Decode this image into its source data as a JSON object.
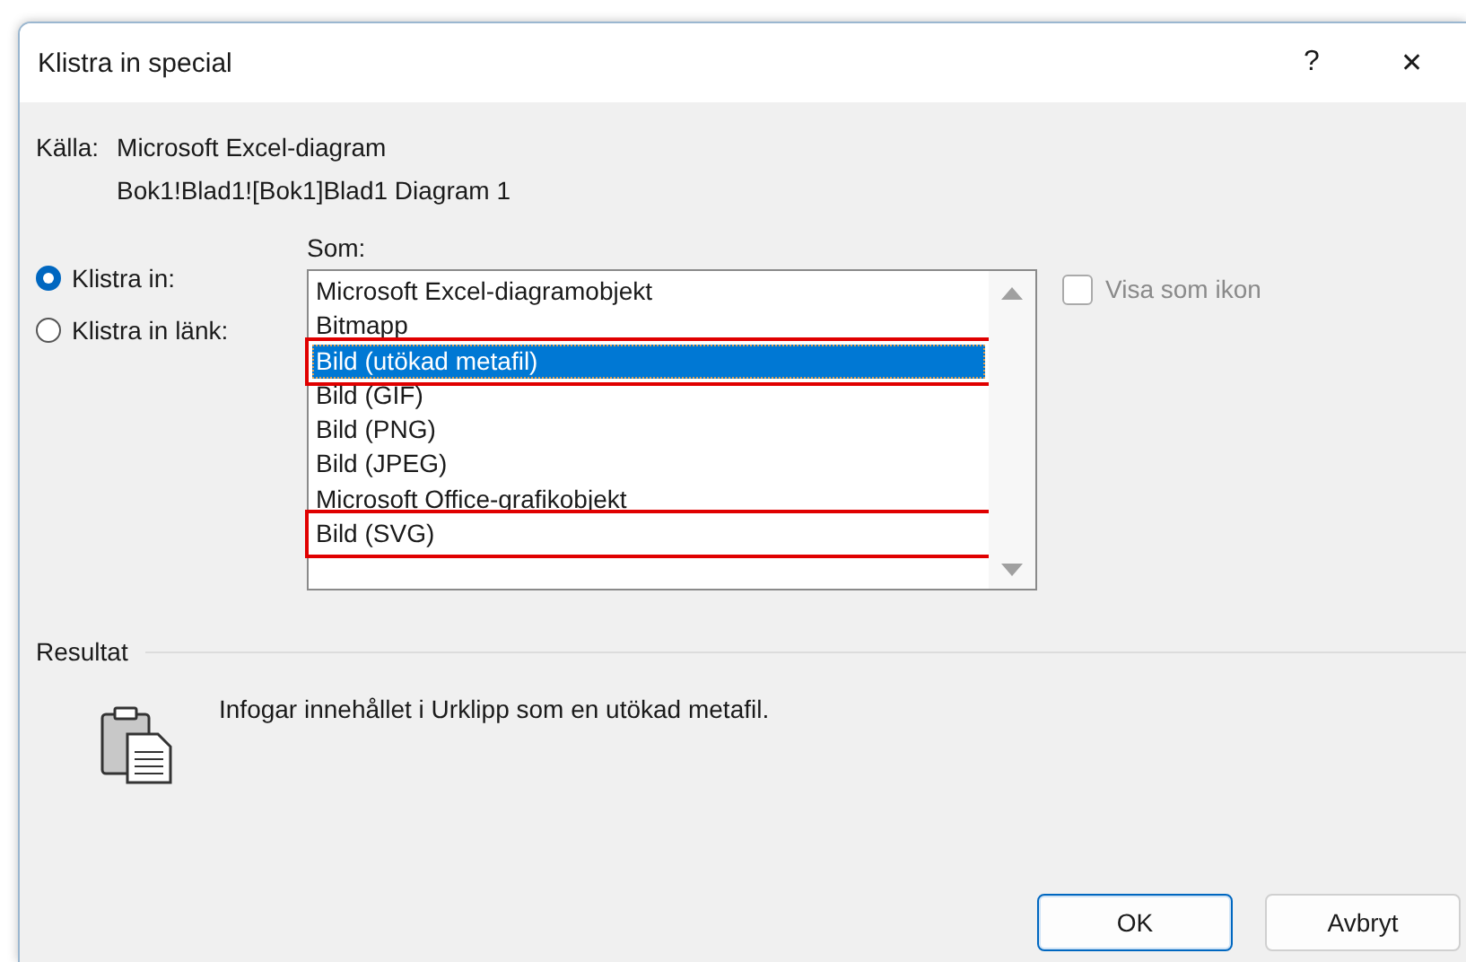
{
  "window": {
    "title": "Klistra in special",
    "help": "?",
    "close": "✕"
  },
  "source": {
    "label": "Källa:",
    "lines": [
      "Microsoft Excel-diagram",
      "Bok1!Blad1![Bok1]Blad1 Diagram 1"
    ]
  },
  "options": [
    {
      "label": "Klistra in:",
      "selected": true
    },
    {
      "label": "Klistra in länk:",
      "selected": false
    }
  ],
  "as_list": {
    "label": "Som:",
    "items": [
      {
        "label": "Microsoft Excel-diagramobjekt",
        "selected": false,
        "highlighted": false
      },
      {
        "label": "Bitmapp",
        "selected": false,
        "highlighted": false
      },
      {
        "label": "Bild (utökad metafil)",
        "selected": true,
        "highlighted": true
      },
      {
        "label": "Bild (GIF)",
        "selected": false,
        "highlighted": false
      },
      {
        "label": "Bild (PNG)",
        "selected": false,
        "highlighted": false
      },
      {
        "label": "Bild (JPEG)",
        "selected": false,
        "highlighted": false
      },
      {
        "label": "Microsoft Office-grafikobjekt",
        "selected": false,
        "highlighted": false
      },
      {
        "label": "Bild (SVG)",
        "selected": false,
        "highlighted": true
      }
    ]
  },
  "show_as_icon": {
    "label": "Visa som ikon",
    "checked": false,
    "disabled": true
  },
  "result": {
    "label": "Resultat",
    "text": "Infogar innehållet i Urklipp som en utökad metafil."
  },
  "buttons": [
    {
      "label": "OK",
      "default": true
    },
    {
      "label": "Avbryt",
      "default": false
    }
  ]
}
